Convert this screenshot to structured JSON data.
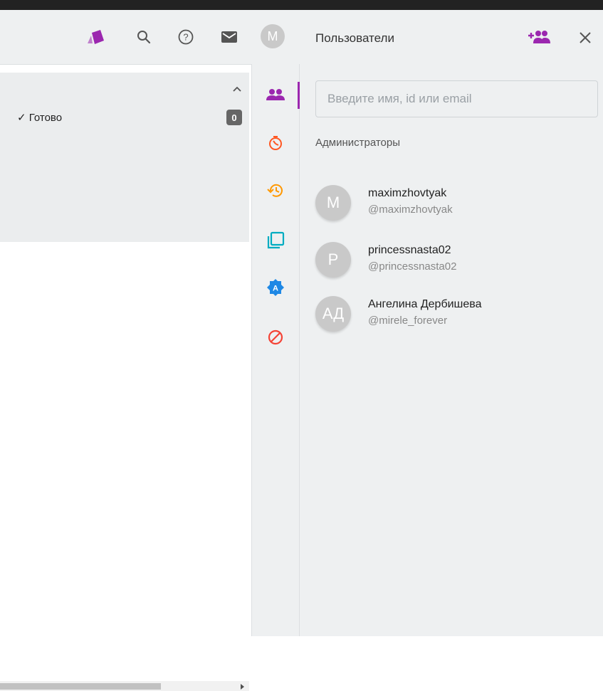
{
  "header": {
    "avatar_letter": "M",
    "icons": [
      "cards-icon",
      "search-icon",
      "help-icon",
      "mail-icon"
    ],
    "brand_color": "#9b27af"
  },
  "board": {
    "column": {
      "title": "Готово",
      "count": "0",
      "check": "✓"
    }
  },
  "rail": {
    "items": [
      {
        "name": "members-icon",
        "color": "#9b27af"
      },
      {
        "name": "timer-icon",
        "color": "#ff5722"
      },
      {
        "name": "history-icon",
        "color": "#ff9800"
      },
      {
        "name": "copy-icon",
        "color": "#00acc1"
      },
      {
        "name": "badge-a-icon",
        "color": "#1e88e5"
      },
      {
        "name": "block-icon",
        "color": "#f44336"
      }
    ],
    "badge_letter": "A"
  },
  "panel": {
    "title": "Пользователи",
    "search_placeholder": "Введите имя, id или email",
    "section_title": "Администраторы",
    "users": [
      {
        "initials": "M",
        "name": "maximzhovtyak",
        "handle": "@maximzhovtyak"
      },
      {
        "initials": "P",
        "name": "princessnasta02",
        "handle": "@princessnasta02"
      },
      {
        "initials": "АД",
        "name": "Ангелина Дербишева",
        "handle": "@mirele_forever"
      }
    ]
  }
}
